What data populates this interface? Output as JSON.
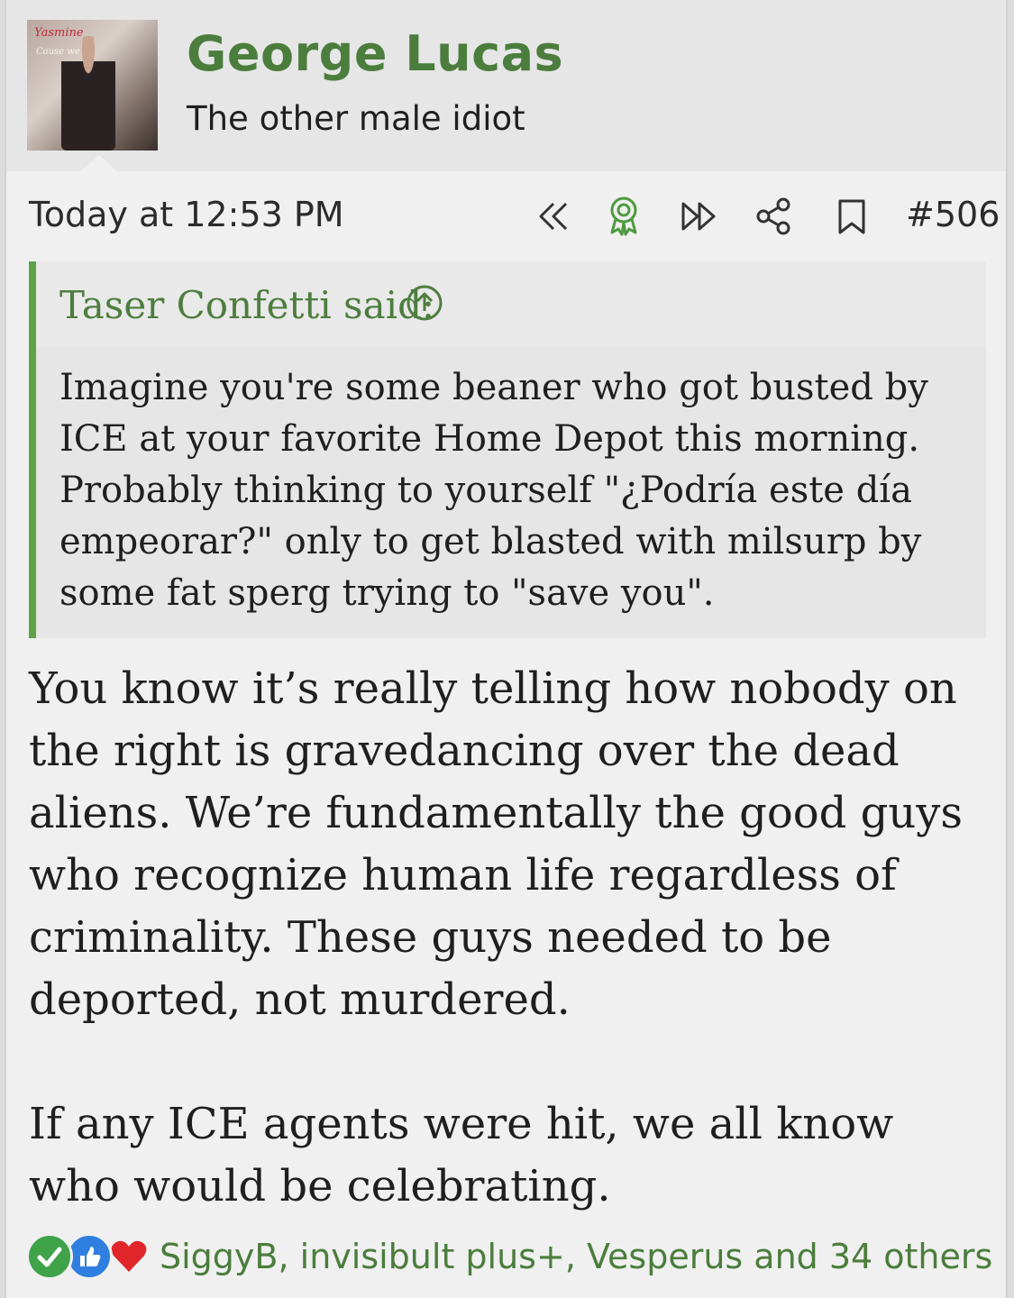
{
  "user": {
    "name": "George Lucas",
    "title": "The other male idiot",
    "avatar_text": [
      "Yasmine",
      "Cause we"
    ]
  },
  "post": {
    "date": "Today at 12:53 PM",
    "number": "#506",
    "actions": [
      "rewind-icon",
      "award-icon",
      "fast-forward-icon",
      "share-icon",
      "bookmark-icon"
    ]
  },
  "quote": {
    "author": "Taser Confetti said:",
    "body": "Imagine you're some beaner who got busted by ICE at your favorite Home Depot this morning. Probably thinking to yourself \"¿Podría este día empeorar?\" only to get blasted with milsurp by some fat sperg trying to \"save you\"."
  },
  "message": {
    "paragraphs": [
      "You know it’s really telling how nobody on the right is gravedancing over the dead aliens. We’re fundamentally the good guys who recognize human life regardless of criminality. These guys needed to be deported, not murdered.",
      "If any ICE agents were hit, we all know who would be celebrating."
    ]
  },
  "reactions": {
    "icons": [
      "check-icon",
      "thumbs-up-icon",
      "heart-icon"
    ],
    "text": "SiggyB, invisibult plus+, Vesperus and 34 others"
  },
  "colors": {
    "accent_green": "#4b7d3c",
    "quote_bar": "#5ea34a",
    "check": "#3fa34a",
    "like": "#2f7fe0",
    "heart": "#e0262b"
  }
}
